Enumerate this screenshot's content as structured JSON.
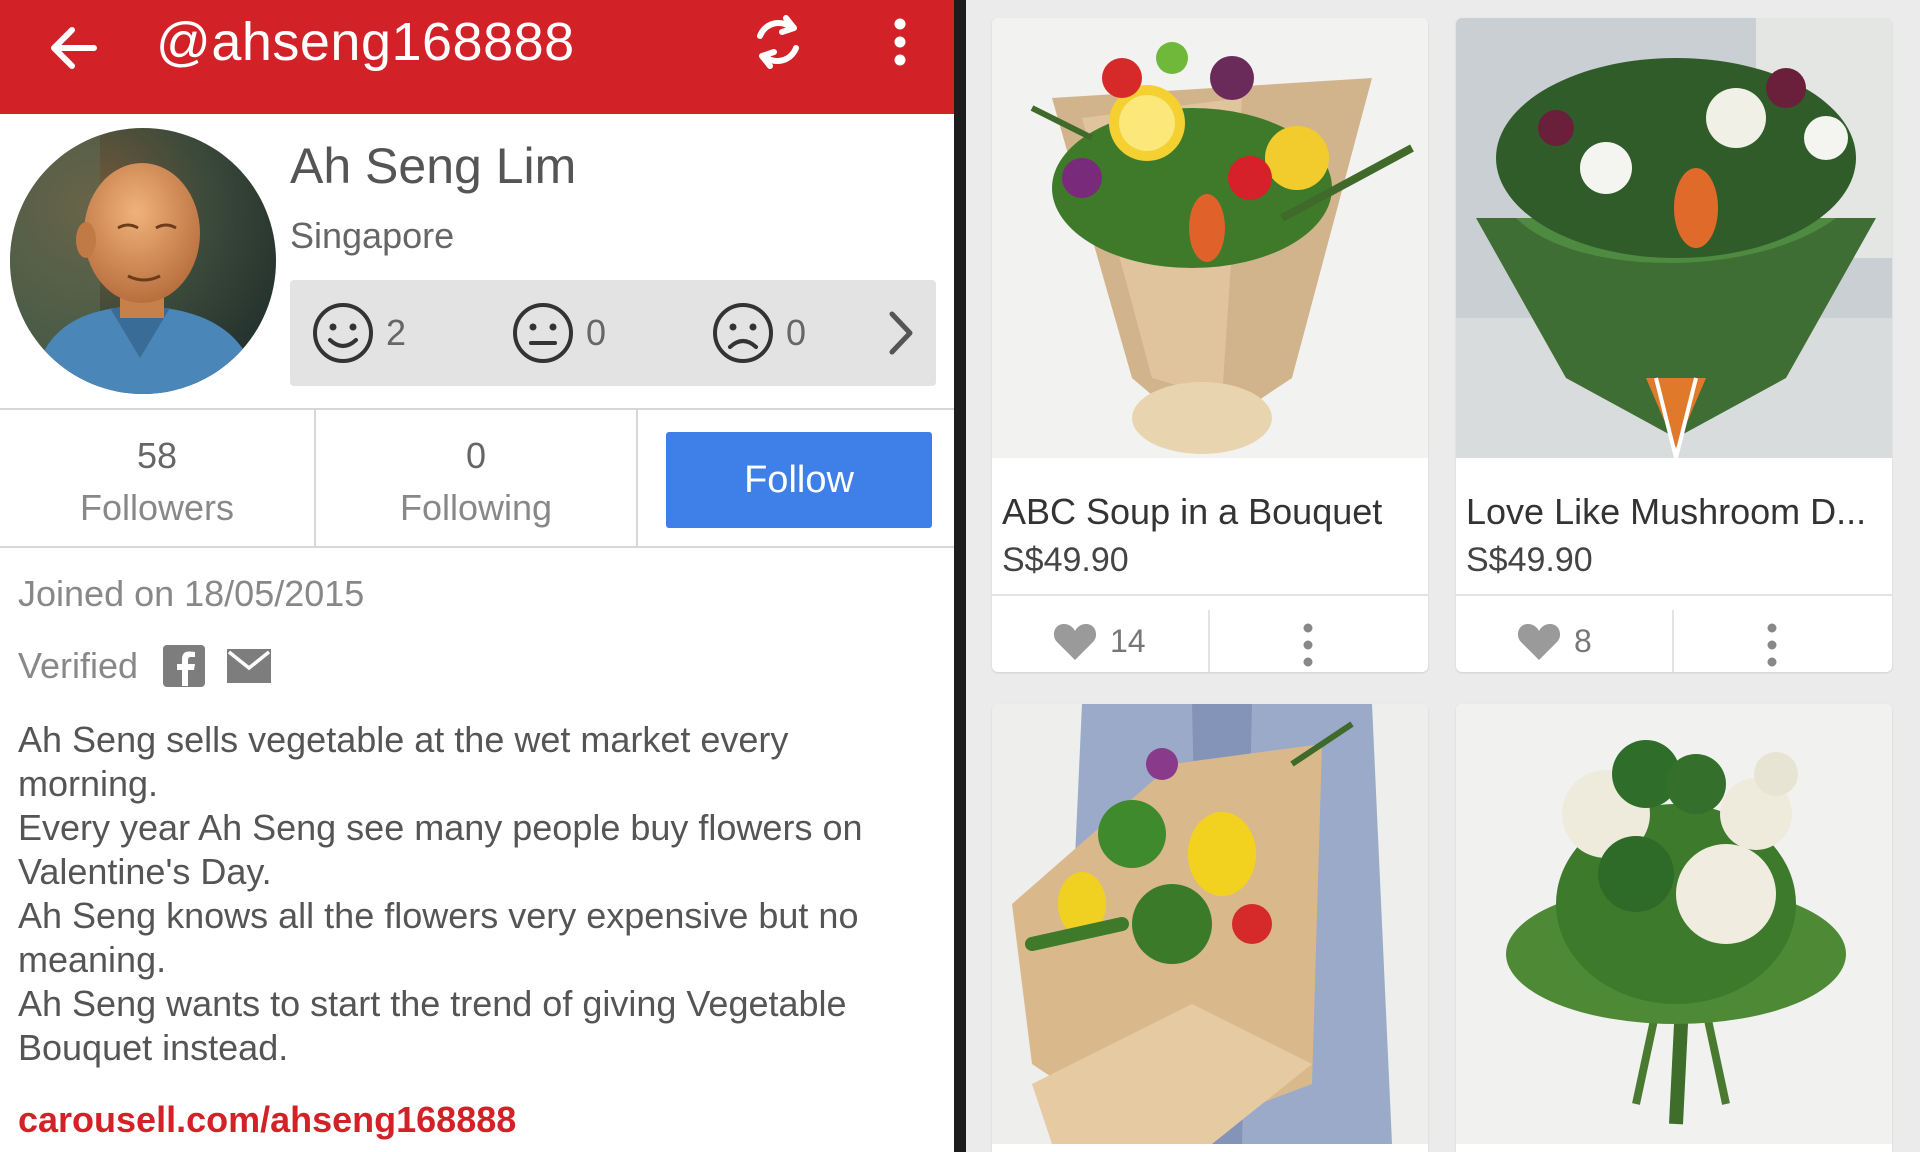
{
  "appbar": {
    "title": "@ahseng168888",
    "color": "#d32128"
  },
  "profile": {
    "name": "Ah Seng Lim",
    "location": "Singapore",
    "ratings": {
      "positive": "2",
      "neutral": "0",
      "negative": "0"
    },
    "followers_count": "58",
    "followers_label": "Followers",
    "following_count": "0",
    "following_label": "Following",
    "follow_button": "Follow",
    "joined": "Joined on 18/05/2015",
    "verified_label": "Verified",
    "bio": [
      "Ah Seng sells vegetable at the wet market every morning.",
      "Every year Ah Seng see many people buy flowers on Valentine's Day.",
      "Ah Seng knows all the flowers very expensive but no meaning.",
      "Ah Seng wants to start the trend of giving Vegetable Bouquet instead."
    ],
    "link": "carousell.com/ahseng168888"
  },
  "listings": [
    {
      "title": "ABC Soup in a Bouquet",
      "price": "S$49.90",
      "likes": "14"
    },
    {
      "title": "Love Like Mushroom D...",
      "price": "S$49.90",
      "likes": "8"
    },
    {
      "title": "",
      "price": "",
      "likes": ""
    },
    {
      "title": "",
      "price": "",
      "likes": ""
    }
  ],
  "colors": {
    "brand_red": "#d32128",
    "follow_blue": "#3f7fe8",
    "background_gray": "#ebebeb"
  },
  "icons": {
    "back": "arrow-left-icon",
    "refresh": "refresh-icon",
    "overflow": "more-vertical-icon",
    "positive": "smile-icon",
    "neutral": "neutral-face-icon",
    "negative": "frown-icon",
    "chevron": "chevron-right-icon",
    "facebook": "facebook-icon",
    "email": "envelope-icon",
    "like": "heart-icon"
  }
}
